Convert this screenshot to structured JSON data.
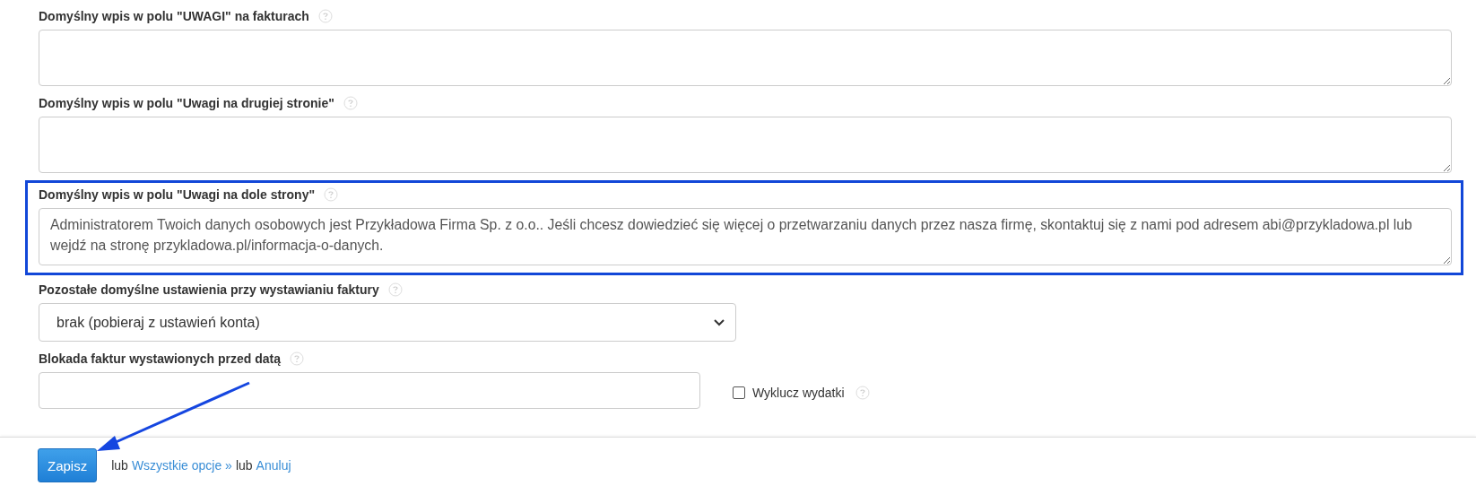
{
  "fields": [
    {
      "kind": "textarea",
      "label": "Domyślny wpis w polu \"UWAGI\" na fakturach",
      "highlighted": false
    },
    {
      "kind": "textarea",
      "label": "Domyślny wpis w polu \"Uwagi na drugiej stronie\"",
      "highlighted": false
    },
    {
      "kind": "textarea",
      "label": "Domyślny wpis w polu \"Uwagi na dole strony\"",
      "value": "Administratorem Twoich danych osobowych jest Przykładowa Firma Sp. z o.o.. Jeśli chcesz dowiedzieć się więcej o przetwarzaniu danych przez nasza firmę, skontaktuj się z nami pod adresem abi@przykladowa.pl lub wejdź na stronę przykladowa.pl/informacja-o-danych.",
      "highlighted": true
    },
    {
      "kind": "select",
      "label": "Pozostałe domyślne ustawienia przy wystawianiu faktury",
      "value": "brak (pobieraj z ustawień konta)",
      "highlighted": false
    },
    {
      "kind": "input",
      "label": "Blokada faktur wystawionych przed datą",
      "highlighted": false,
      "checkbox": {
        "label": "Wyklucz wydatki",
        "checked": false
      }
    }
  ],
  "footer": {
    "button": "Zapisz",
    "separator_1": "lub",
    "link_1": "Wszystkie opcje »",
    "separator_2": "lub",
    "link_2": "Anuluj"
  }
}
